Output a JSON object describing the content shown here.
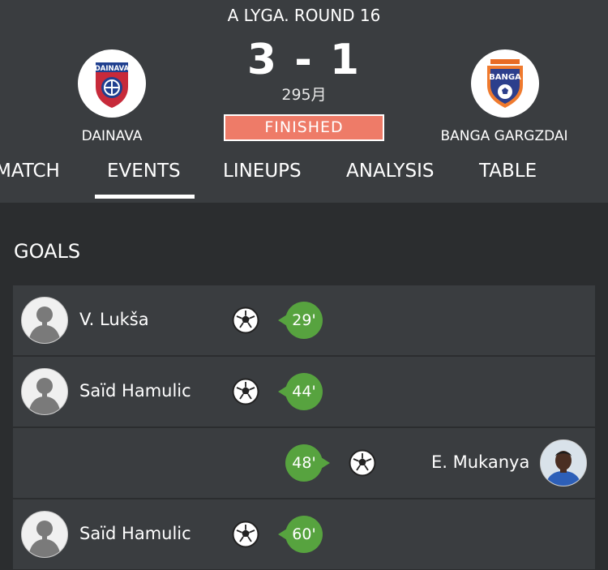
{
  "match": {
    "competition": "A LYGA. ROUND 16",
    "score": "3 - 1",
    "attendance": "295月",
    "status": "FINISHED",
    "home_team": "DAINAVA",
    "away_team": "BANGA GARGZDAI",
    "home_crest_text": "DAINAVA",
    "away_crest_text": "BANGA",
    "status_color": "#ee7b68"
  },
  "tabs": [
    {
      "label": "MATCH"
    },
    {
      "label": "EVENTS",
      "active": true
    },
    {
      "label": "LINEUPS"
    },
    {
      "label": "ANALYSIS"
    },
    {
      "label": "TABLE"
    }
  ],
  "goals": {
    "title": "GOALS",
    "events": [
      {
        "player": "V. Lukša",
        "minute": "29'",
        "side": "home"
      },
      {
        "player": "Saïd Hamulic",
        "minute": "44'",
        "side": "home"
      },
      {
        "player": "E. Mukanya",
        "minute": "48'",
        "side": "away"
      },
      {
        "player": "Saïd Hamulic",
        "minute": "60'",
        "side": "home"
      }
    ]
  },
  "icons": {
    "ball": "soccer-ball-icon",
    "avatar": "player-avatar-icon"
  },
  "colors": {
    "minute_badge": "#57a33f",
    "header_bg": "#3a3d40",
    "page_bg": "#2b2d2f"
  }
}
